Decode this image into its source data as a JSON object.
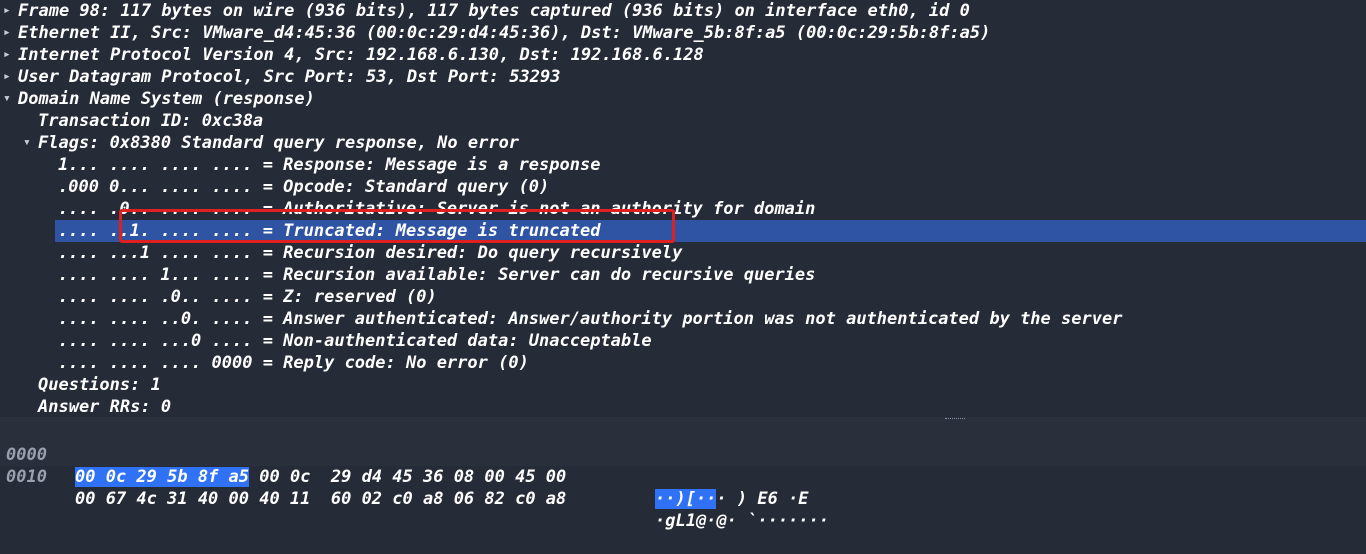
{
  "tree": [
    {
      "text": "Frame 98: 117 bytes on wire (936 bits), 117 bytes captured (936 bits) on interface eth0, id 0",
      "arrow": "▸"
    },
    {
      "text": "Ethernet II, Src: VMware_d4:45:36 (00:0c:29:d4:45:36), Dst: VMware_5b:8f:a5 (00:0c:29:5b:8f:a5)",
      "arrow": "▸"
    },
    {
      "text": "Internet Protocol Version 4, Src: 192.168.6.130, Dst: 192.168.6.128",
      "arrow": "▸"
    },
    {
      "text": "User Datagram Protocol, Src Port: 53, Dst Port: 53293",
      "arrow": "▸"
    },
    {
      "text": "Domain Name System (response)",
      "arrow": "▾"
    },
    {
      "text": "Transaction ID: 0xc38a",
      "arrow": ""
    },
    {
      "text": "Flags: 0x8380 Standard query response, No error",
      "arrow": "▾"
    },
    {
      "text": "1... .... .... .... = Response: Message is a response",
      "arrow": ""
    },
    {
      "text": ".000 0... .... .... = Opcode: Standard query (0)",
      "arrow": ""
    },
    {
      "text": ".... .0.. .... .... = Authoritative: Server is not an authority for domain",
      "arrow": ""
    },
    {
      "text": ".... ..1. .... .... = Truncated: Message is truncated",
      "arrow": ""
    },
    {
      "text": ".... ...1 .... .... = Recursion desired: Do query recursively",
      "arrow": ""
    },
    {
      "text": ".... .... 1... .... = Recursion available: Server can do recursive queries",
      "arrow": ""
    },
    {
      "text": ".... .... .0.. .... = Z: reserved (0)",
      "arrow": ""
    },
    {
      "text": ".... .... ..0. .... = Answer authenticated: Answer/authority portion was not authenticated by the server",
      "arrow": ""
    },
    {
      "text": ".... .... ...0 .... = Non-authenticated data: Unacceptable",
      "arrow": ""
    },
    {
      "text": ".... .... .... 0000 = Reply code: No error (0)",
      "arrow": ""
    },
    {
      "text": "Questions: 1",
      "arrow": ""
    },
    {
      "text": "Answer RRs: 0",
      "arrow": ""
    }
  ],
  "hex": [
    {
      "offset": "0000",
      "bytes_hl": "00 0c 29 5b 8f a5",
      "bytes_rest": " 00 0c  29 d4 45 36 08 00 45 00",
      "ascii_hl": "··)[··",
      "ascii_rest": "· ) E6 ·E"
    },
    {
      "offset": "0010",
      "bytes_hl": "",
      "bytes_rest": "00 67 4c 31 40 00 40 11  60 02 c0 a8 06 82 c0 a8",
      "ascii_hl": "",
      "ascii_rest": "·gL1@·@· `·······"
    }
  ],
  "colors": {
    "background": "#262b38",
    "selection": "#2f54a3",
    "annotation": "#e02020",
    "hex_highlight": "#2f72f5"
  }
}
